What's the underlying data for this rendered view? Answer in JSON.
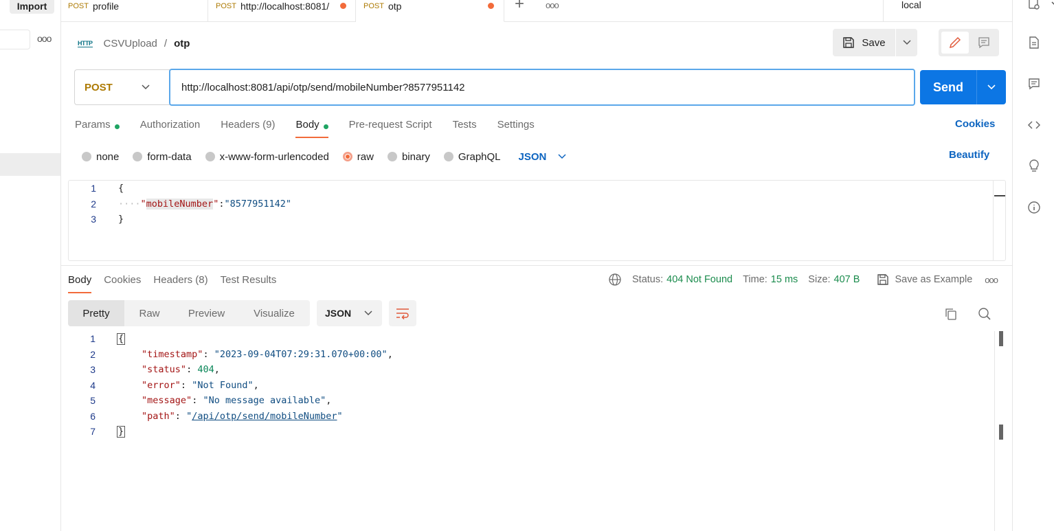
{
  "sidebar": {
    "import_label": "Import",
    "more_label": "ooo"
  },
  "tabs": [
    {
      "method": "POST",
      "label": "profile",
      "unsaved": false
    },
    {
      "method": "POST",
      "label": "http://localhost:8081/",
      "unsaved": true
    },
    {
      "method": "POST",
      "label": "otp",
      "unsaved": true
    }
  ],
  "tab_actions": {
    "new_tab": "+",
    "more": "ooo"
  },
  "environment": {
    "selected": "local"
  },
  "breadcrumb": {
    "icon_text": "HTTP",
    "collection": "CSVUpload",
    "separator": "/",
    "request_name": "otp"
  },
  "toolbar": {
    "save_label": "Save"
  },
  "request": {
    "method": "POST",
    "url": "http://localhost:8081/api/otp/send/mobileNumber?8577951142",
    "send_label": "Send"
  },
  "request_tabs": [
    {
      "label": "Params",
      "indicator": true,
      "active": false
    },
    {
      "label": "Authorization",
      "indicator": false,
      "active": false
    },
    {
      "label": "Headers",
      "count": "(9)",
      "indicator": false,
      "active": false
    },
    {
      "label": "Body",
      "indicator": true,
      "active": true
    },
    {
      "label": "Pre-request Script",
      "indicator": false,
      "active": false
    },
    {
      "label": "Tests",
      "indicator": false,
      "active": false
    },
    {
      "label": "Settings",
      "indicator": false,
      "active": false
    }
  ],
  "cookies_label": "Cookies",
  "body_modes": [
    "none",
    "form-data",
    "x-www-form-urlencoded",
    "raw",
    "binary",
    "GraphQL"
  ],
  "body_mode_selected": "raw",
  "body_language": "JSON",
  "beautify_label": "Beautify",
  "request_body": {
    "line_numbers": [
      "1",
      "2",
      "3"
    ],
    "open_brace": "{",
    "key": "mobileNumber",
    "value": "8577951142",
    "close_brace": "}"
  },
  "response_tabs": [
    {
      "label": "Body",
      "active": true
    },
    {
      "label": "Cookies",
      "active": false
    },
    {
      "label": "Headers",
      "count": "(8)",
      "active": false
    },
    {
      "label": "Test Results",
      "active": false
    }
  ],
  "response_meta": {
    "status_label": "Status:",
    "status_value": "404 Not Found",
    "time_label": "Time:",
    "time_value": "15 ms",
    "size_label": "Size:",
    "size_value": "407 B",
    "save_example_label": "Save as Example",
    "more": "ooo"
  },
  "view_tabs": [
    "Pretty",
    "Raw",
    "Preview",
    "Visualize"
  ],
  "view_tab_selected": "Pretty",
  "response_language": "JSON",
  "response_body": {
    "line_numbers": [
      "1",
      "2",
      "3",
      "4",
      "5",
      "6",
      "7"
    ],
    "fields": [
      {
        "key": "timestamp",
        "value": "2023-09-04T07:29:31.070+00:00",
        "type": "string"
      },
      {
        "key": "status",
        "value": "404",
        "type": "number"
      },
      {
        "key": "error",
        "value": "Not Found",
        "type": "string"
      },
      {
        "key": "message",
        "value": "No message available",
        "type": "string"
      },
      {
        "key": "path",
        "value": "/api/otp/send/mobileNumber",
        "type": "link"
      }
    ]
  },
  "colors": {
    "accent": "#f26b3a",
    "primary": "#0c76e4",
    "method": "#ad7a03",
    "success": "#1a8b4c"
  }
}
